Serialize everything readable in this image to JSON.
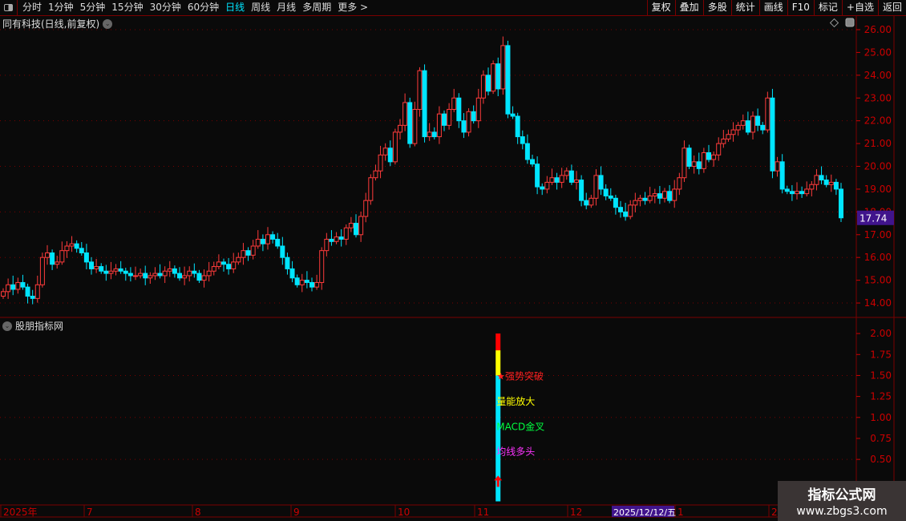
{
  "toolbar": {
    "periods": [
      "分时",
      "1分钟",
      "5分钟",
      "15分钟",
      "30分钟",
      "60分钟",
      "日线",
      "周线",
      "月线",
      "多周期",
      "更多 >"
    ],
    "active_period": "日线",
    "right_buttons": [
      "复权",
      "叠加",
      "多股",
      "统计",
      "画线",
      "F10",
      "标记",
      "+自选",
      "返回"
    ]
  },
  "main_title": "同有科技(日线,前复权)",
  "indicator_title": "股朋指标网",
  "colors": {
    "up": "#ff3b3b",
    "down": "#00e5ff",
    "axis": "#cc0000",
    "grid": "#7a0000",
    "highlight": "#40148c"
  },
  "chart_data": [
    {
      "type": "candlestick",
      "title": "同有科技(日线,前复权)",
      "ylim": [
        13.6,
        26.3
      ],
      "y_ticks": [
        "26.00",
        "25.00",
        "24.00",
        "23.00",
        "22.00",
        "21.00",
        "20.00",
        "19.00",
        "18.00",
        "17.00",
        "16.00",
        "15.00",
        "14.00"
      ],
      "last_price": "17.74",
      "x_ticks": [
        "2025年",
        "7",
        "8",
        "9",
        "10",
        "11",
        "12",
        "1",
        "2"
      ],
      "cursor_date": "2025/12/12/五",
      "closes": [
        14.5,
        14.8,
        14.6,
        14.9,
        14.7,
        14.3,
        14.2,
        14.8,
        16.0,
        16.2,
        15.7,
        15.8,
        16.3,
        16.5,
        16.6,
        16.4,
        16.2,
        15.8,
        15.5,
        15.6,
        15.4,
        15.3,
        15.4,
        15.5,
        15.4,
        15.3,
        15.2,
        15.2,
        15.3,
        15.1,
        15.2,
        15.3,
        15.2,
        15.4,
        15.5,
        15.3,
        15.1,
        15.2,
        15.4,
        15.3,
        15.0,
        15.2,
        15.4,
        15.6,
        15.8,
        15.7,
        15.5,
        15.8,
        16.0,
        16.3,
        16.1,
        16.5,
        16.8,
        16.6,
        17.0,
        16.8,
        16.5,
        16.0,
        15.5,
        15.1,
        14.8,
        15.0,
        14.9,
        14.7,
        14.9,
        16.3,
        16.8,
        16.7,
        16.9,
        16.8,
        17.3,
        17.5,
        17.0,
        17.8,
        18.5,
        19.5,
        19.8,
        20.5,
        20.8,
        20.2,
        21.5,
        21.8,
        22.8,
        21.0,
        22.5,
        24.2,
        21.3,
        21.5,
        21.3,
        22.3,
        21.8,
        22.5,
        23.0,
        22.0,
        21.5,
        22.4,
        22.0,
        23.0,
        24.0,
        23.3,
        24.5,
        23.4,
        25.3,
        22.3,
        22.2,
        21.3,
        21.0,
        20.3,
        20.1,
        19.1,
        19.0,
        19.3,
        19.5,
        19.3,
        19.6,
        19.8,
        19.3,
        19.4,
        18.5,
        18.3,
        18.6,
        19.6,
        19.0,
        18.7,
        18.6,
        18.2,
        18.0,
        17.8,
        18.3,
        18.5,
        18.6,
        18.5,
        18.7,
        18.8,
        18.6,
        18.9,
        18.5,
        19.0,
        19.5,
        20.8,
        20.0,
        20.2,
        19.9,
        20.6,
        20.3,
        20.5,
        21.0,
        21.2,
        21.4,
        21.6,
        21.8,
        22.0,
        21.5,
        22.2,
        21.8,
        21.6,
        23.0,
        19.8,
        20.2,
        19.0,
        18.9,
        18.8,
        18.9,
        18.8,
        19.0,
        19.2,
        19.6,
        19.4,
        19.2,
        19.3,
        19.0,
        17.74
      ]
    },
    {
      "type": "bar",
      "title": "股朋指标网",
      "ylim": [
        0,
        2.0
      ],
      "y_ticks": [
        "2.00",
        "1.75",
        "1.50",
        "1.25",
        "1.00",
        "0.75",
        "0.50"
      ],
      "segments": [
        {
          "from": 0,
          "to": 1.5,
          "color": "#00e5ff"
        },
        {
          "from": 1.5,
          "to": 1.8,
          "color": "#ffff00"
        },
        {
          "from": 1.8,
          "to": 2.0,
          "color": "#ff0000"
        }
      ],
      "bar_index": 101,
      "signals": [
        {
          "text": "★强势突破",
          "value": 1.5,
          "color": "#ff2020"
        },
        {
          "text": "量能放大",
          "value": 1.2,
          "color": "#ffff00"
        },
        {
          "text": "MACD金叉",
          "value": 0.9,
          "color": "#00ff40"
        },
        {
          "text": "均线多头",
          "value": 0.6,
          "color": "#ff33ff"
        }
      ],
      "arrow": {
        "value": 0.25,
        "icon": "arrow-up-icon",
        "color": "#ff0000"
      }
    }
  ],
  "watermark": {
    "name": "指标公式网",
    "url": "www.zbgs3.com"
  }
}
